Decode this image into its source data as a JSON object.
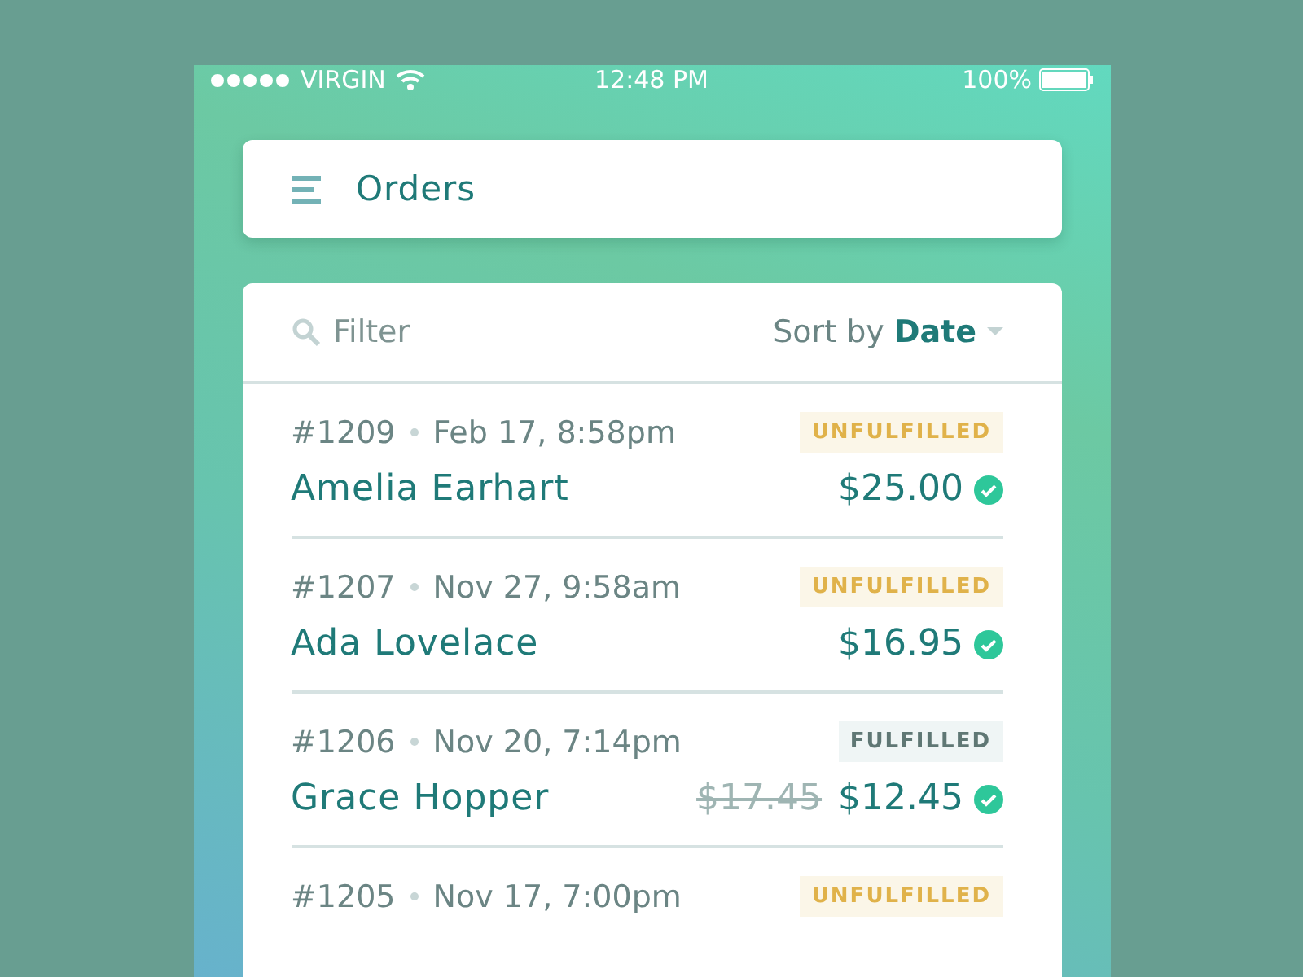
{
  "status_bar": {
    "carrier": "VIRGIN",
    "time": "12:48 PM",
    "battery": "100%"
  },
  "header": {
    "title": "Orders"
  },
  "toolbar": {
    "filter": {
      "placeholder": "Filter"
    },
    "sort_label": "Sort by",
    "sort_value": "Date"
  },
  "orders": [
    {
      "number": "#1209",
      "date": "Feb 17, 8:58pm",
      "status": {
        "kind": "unfulfilled",
        "label": "UNFULFILLED"
      },
      "customer": "Amelia Earhart",
      "price": "$25.00",
      "paid": true
    },
    {
      "number": "#1207",
      "date": "Nov 27, 9:58am",
      "status": {
        "kind": "unfulfilled",
        "label": "UNFULFILLED"
      },
      "customer": "Ada Lovelace",
      "price": "$16.95",
      "paid": true
    },
    {
      "number": "#1206",
      "date": "Nov 20, 7:14pm",
      "status": {
        "kind": "fulfilled",
        "label": "FULFILLED"
      },
      "customer": "Grace Hopper",
      "original_price": "$17.45",
      "price": "$12.45",
      "paid": true
    },
    {
      "number": "#1205",
      "date": "Nov 17, 7:00pm",
      "status": {
        "kind": "unfulfilled",
        "label": "UNFULFILLED"
      }
    }
  ]
}
